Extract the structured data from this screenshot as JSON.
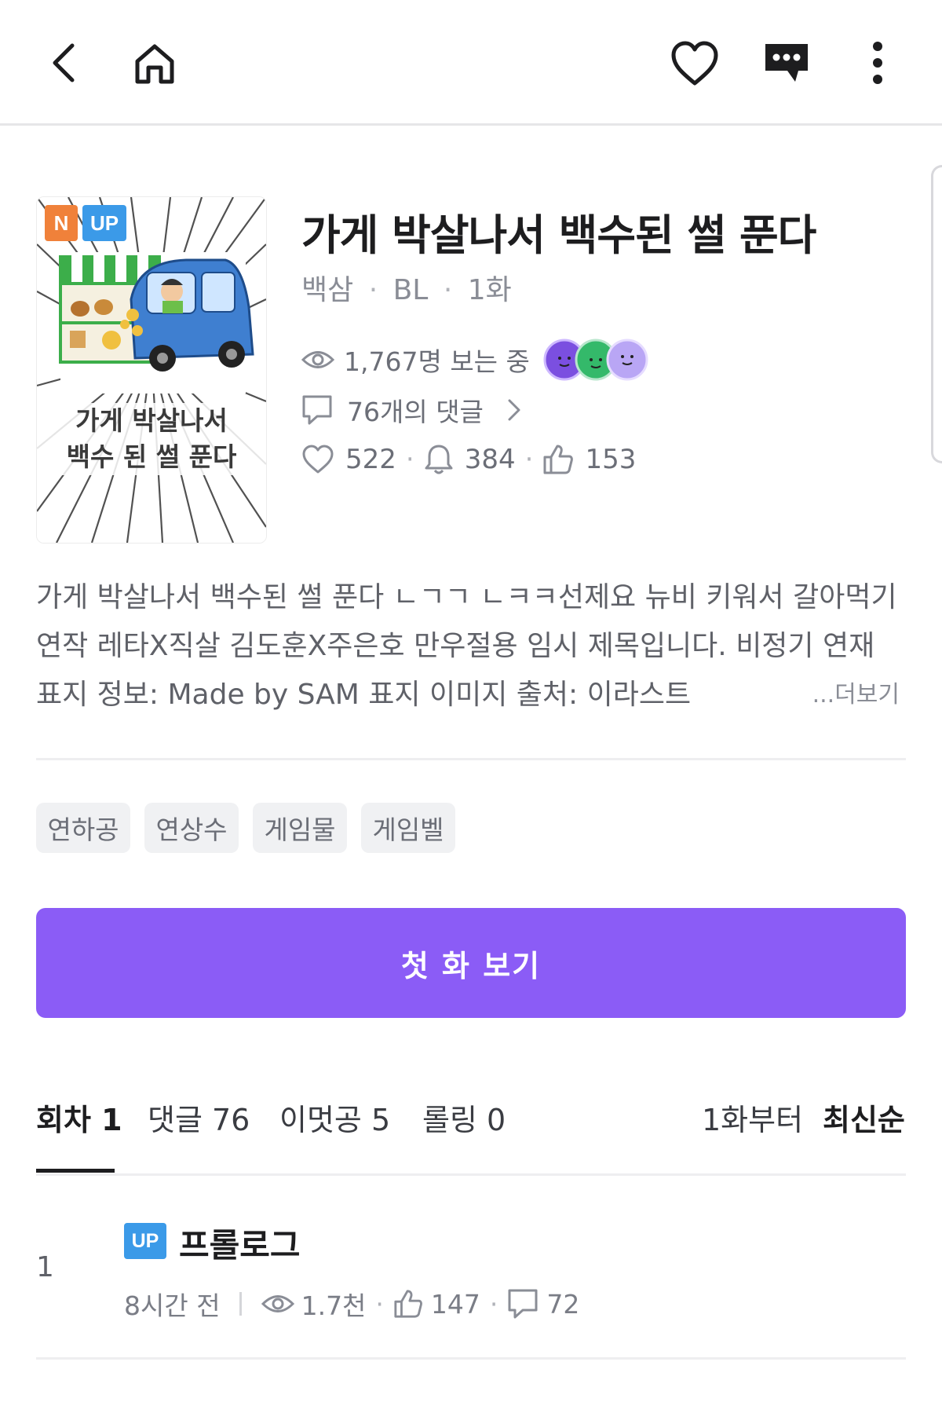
{
  "icons": {
    "back": "chevron-left-icon",
    "home": "home-icon",
    "like": "heart-icon",
    "chat": "chat-bubble-icon",
    "menu": "more-vertical-icon"
  },
  "colors": {
    "accent": "#8b5cf6",
    "badge_n": "#f0813a",
    "badge_up": "#3b9ae8"
  },
  "cover": {
    "badge_new": "N",
    "badge_up": "UP",
    "caption_line1": "가게 박살나서",
    "caption_line2": "백수 된 썰 푼다"
  },
  "header": {
    "title": "가게 박살나서 백수된 썰 푼다",
    "author": "백삼",
    "genre": "BL",
    "episodes": "1화",
    "viewers": "1,767명 보는 중",
    "comments": "76개의 댓글",
    "likes": "522",
    "alerts": "384",
    "thumbs": "153"
  },
  "description": {
    "text": "가게 박살나서 백수된 썰 푼다 ㄴㄱㄱ ㄴㅋㅋ선제요 뉴비 키워서 갈아먹기 연작 레타X직살 김도훈X주은호 만우절용 임시 제목입니다. 비정기 연재 표지 정보: Made by SAM 표지 이미지 출처: 이라스트",
    "more": "...더보기"
  },
  "tags": [
    "연하공",
    "연상수",
    "게임물",
    "게임벨"
  ],
  "cta": "첫 화 보기",
  "tabs": {
    "episodes": "회차 1",
    "comments": "댓글 76",
    "imeotgong": "이멋공 5",
    "rolling": "롤링 0",
    "from_first": "1화부터",
    "latest": "최신순"
  },
  "episode": {
    "number": "1",
    "badge": "UP",
    "title": "프롤로그",
    "time": "8시간 전",
    "views": "1.7천",
    "likes": "147",
    "comments": "72"
  }
}
